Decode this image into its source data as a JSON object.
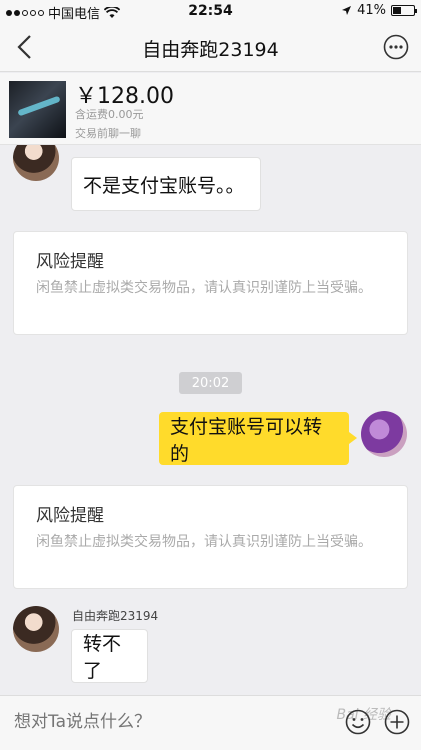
{
  "status_bar": {
    "carrier": "中国电信",
    "time": "22:54",
    "battery_percent": "41%",
    "battery_level": 0.41
  },
  "nav": {
    "title": "自由奔跑23194"
  },
  "product": {
    "price": "￥128.00",
    "shipping": "含运费0.00元",
    "note": "交易前聊一聊"
  },
  "messages": {
    "msg1": "不是支付宝账号。。",
    "risk1_title": "风险提醒",
    "risk1_text": "闲鱼禁止虚拟类交易物品，请认真识别谨防上当受骗。",
    "timestamp": "20:02",
    "msg2": "支付宝账号可以转的",
    "risk2_title": "风险提醒",
    "risk2_text": "闲鱼禁止虚拟类交易物品，请认真识别谨防上当受骗。",
    "sender_name": "自由奔跑23194",
    "msg3": "转不了"
  },
  "input": {
    "placeholder": "想对Ta说点什么？"
  },
  "watermark": "Bai 经验",
  "icons": {
    "back": "chevron-left-icon",
    "more": "more-icon",
    "emoji": "emoji-icon",
    "plus": "plus-icon",
    "wifi": "wifi-icon",
    "location": "location-icon",
    "battery": "battery-icon"
  },
  "colors": {
    "accent_yellow": "#ffdb2b",
    "background": "#eeeef1"
  }
}
